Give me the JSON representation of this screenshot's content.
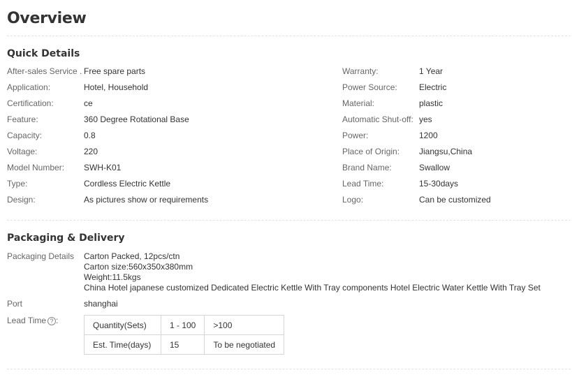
{
  "overview": {
    "title": "Overview"
  },
  "quick_details": {
    "title": "Quick Details",
    "rows": [
      {
        "left_label": "After-sales Service ...",
        "left_value": "Free spare parts",
        "right_label": "Warranty:",
        "right_value": "1 Year"
      },
      {
        "left_label": "Application:",
        "left_value": "Hotel, Household",
        "right_label": "Power Source:",
        "right_value": "Electric"
      },
      {
        "left_label": "Certification:",
        "left_value": "ce",
        "right_label": "Material:",
        "right_value": "plastic"
      },
      {
        "left_label": "Feature:",
        "left_value": "360 Degree Rotational Base",
        "right_label": "Automatic Shut-off:",
        "right_value": "yes"
      },
      {
        "left_label": "Capacity:",
        "left_value": "0.8",
        "right_label": "Power:",
        "right_value": "1200"
      },
      {
        "left_label": "Voltage:",
        "left_value": "220",
        "right_label": "Place of Origin:",
        "right_value": "Jiangsu,China"
      },
      {
        "left_label": "Model Number:",
        "left_value": "SWH-K01",
        "right_label": "Brand Name:",
        "right_value": "Swallow"
      },
      {
        "left_label": "Type:",
        "left_value": "Cordless Electric Kettle",
        "right_label": "Lead Time:",
        "right_value": "15-30days"
      },
      {
        "left_label": "Design:",
        "left_value": "As pictures show or requirements",
        "right_label": "Logo:",
        "right_value": "Can be customized"
      }
    ]
  },
  "packaging": {
    "title": "Packaging & Delivery",
    "details_label": "Packaging Details",
    "details_lines": [
      "Carton Packed, 12pcs/ctn",
      "Carton size:560x350x380mm",
      "Weight:11.5kgs",
      "China Hotel japanese customized Dedicated Electric Kettle With Tray components Hotel Electric Water Kettle With Tray Set"
    ],
    "port_label": "Port",
    "port_value": "shanghai",
    "lead_time_label": "Lead Time",
    "lead_time_colon": ":",
    "help_icon_glyph": "?",
    "lead_table": {
      "rows": [
        [
          "Quantity(Sets)",
          "1 - 100",
          ">100"
        ],
        [
          "Est. Time(days)",
          "15",
          "To be negotiated"
        ]
      ]
    }
  }
}
